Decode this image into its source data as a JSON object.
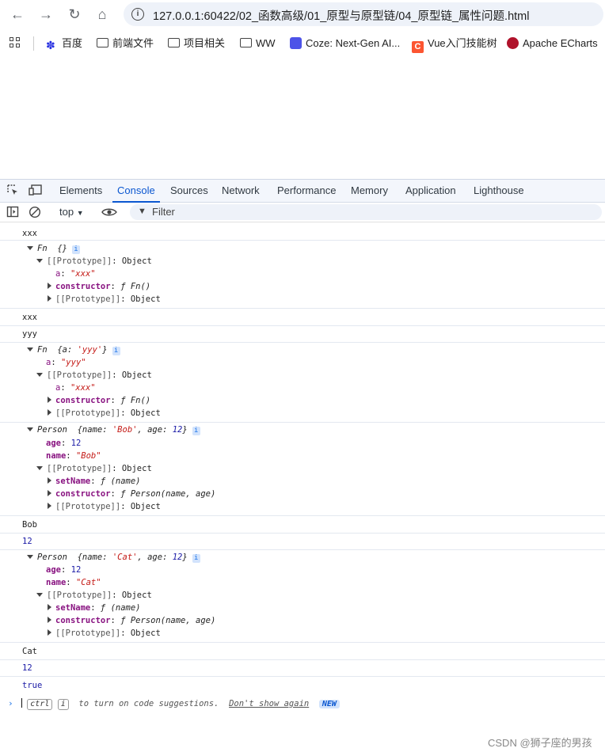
{
  "browser": {
    "url": "127.0.0.1:60422/02_函数高级/01_原型与原型链/04_原型链_属性问题.html",
    "bookmarks": [
      "百度",
      "前端文件",
      "项目相关",
      "WW",
      "Coze: Next-Gen AI...",
      "Vue入门技能树",
      "Apache ECharts"
    ]
  },
  "devtools": {
    "tabs": [
      "Elements",
      "Console",
      "Sources",
      "Network",
      "Performance",
      "Memory",
      "Application",
      "Lighthouse"
    ],
    "active_tab": "Console",
    "context": "top",
    "filter_placeholder": "Filter"
  },
  "console": {
    "out_xxx": "xxx",
    "fn1_header": "Fn",
    "fn1_summary": "{}",
    "proto_label": "[[Prototype]]",
    "object_label": "Object",
    "a_key": "a",
    "a_val_xxx": "\"xxx\"",
    "a_val_yyy": "\"yyy\"",
    "constructor_key": "constructor",
    "fn_val": "ƒ Fn()",
    "out_yyy": "yyy",
    "fn2_summary_a": "{a: ",
    "fn2_summary_v": "'yyy'",
    "fn2_summary_b": "}",
    "person": "Person",
    "bob_summary_a": "{name: ",
    "bob_summary_v": "'Bob'",
    "bob_summary_b": ", age: ",
    "bob_summary_n": "12",
    "bob_summary_c": "}",
    "age_key": "age",
    "age_val": "12",
    "name_key": "name",
    "name_bob": "\"Bob\"",
    "setname_key": "setName",
    "setname_val": "ƒ (name)",
    "person_ctor": "ƒ Person(name, age)",
    "out_bob": "Bob",
    "out_12a": "12",
    "cat_summary_v": "'Cat'",
    "name_cat": "\"Cat\"",
    "out_cat": "Cat",
    "out_12b": "12",
    "out_true": "true",
    "hint_ctrl": "ctrl",
    "hint_i": "i",
    "hint_text": "to turn on code suggestions.",
    "hint_link": "Don't show again",
    "hint_new": "NEW"
  },
  "watermark": "CSDN @狮子座的男孩"
}
